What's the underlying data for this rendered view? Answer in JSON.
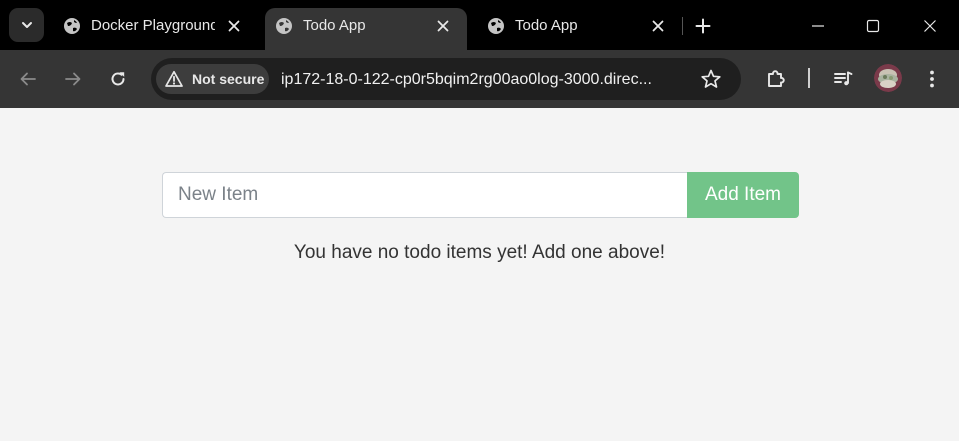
{
  "browser": {
    "tabs": [
      {
        "title": "Docker Playground",
        "active": false
      },
      {
        "title": "Todo App",
        "active": true
      },
      {
        "title": "Todo App",
        "active": false
      }
    ],
    "icons": {
      "tab_search": "chevron-down-icon",
      "tab_favicon": "globe-icon",
      "tab_close": "close-icon",
      "new_tab": "plus-icon",
      "minimize": "minimize-icon",
      "maximize": "maximize-icon",
      "close_window": "close-icon",
      "back": "arrow-left-icon",
      "forward": "arrow-right-icon",
      "reload": "reload-icon",
      "security": "warning-icon",
      "bookmark": "star-icon",
      "extensions": "puzzle-icon",
      "media": "media-control-icon",
      "menu": "three-dots-icon"
    },
    "omnibox": {
      "security_label": "Not secure",
      "url": "ip172-18-0-122-cp0r5bqim2rg00ao0log-3000.direc..."
    }
  },
  "todo": {
    "input_placeholder": "New Item",
    "input_value": "",
    "add_button_label": "Add Item",
    "empty_message": "You have no todo items yet! Add one above!"
  },
  "colors": {
    "tabstrip_bg": "#000000",
    "toolbar_bg": "#353535",
    "omnibox_bg": "#1f1f1f",
    "page_bg": "#f4f4f4",
    "add_button_bg": "#72c489",
    "add_button_text": "#ffffff"
  }
}
